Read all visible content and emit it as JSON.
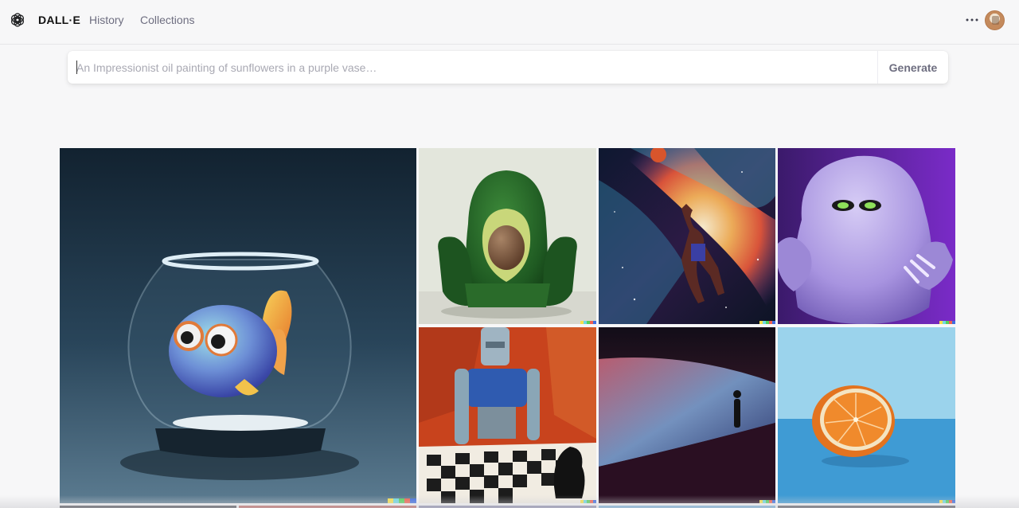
{
  "header": {
    "logo_icon": "openai-logo-icon",
    "brand": "DALL·E",
    "nav": [
      {
        "label": "History"
      },
      {
        "label": "Collections"
      }
    ],
    "more_icon": "more-horizontal-icon",
    "avatar_icon": "user-avatar"
  },
  "prompt": {
    "placeholder": "An Impressionist oil painting of sunflowers in a purple vase…",
    "value": "",
    "generate_label": "Generate"
  },
  "gallery": {
    "images": [
      {
        "subject": "fish-in-bowl-image"
      },
      {
        "subject": "avocado-armchair-image"
      },
      {
        "subject": "space-basketball-image"
      },
      {
        "subject": "purple-monster-image"
      },
      {
        "subject": "robot-chess-image"
      },
      {
        "subject": "desert-figure-image"
      },
      {
        "subject": "orange-half-image"
      }
    ],
    "signature_colors": [
      "#f6e04b",
      "#6fd9e1",
      "#55d05a",
      "#f0614f",
      "#3e6ee0"
    ]
  },
  "colors": {
    "background": "#f7f7f8",
    "nav_text": "#6e6e80",
    "brand_text": "#111111"
  }
}
